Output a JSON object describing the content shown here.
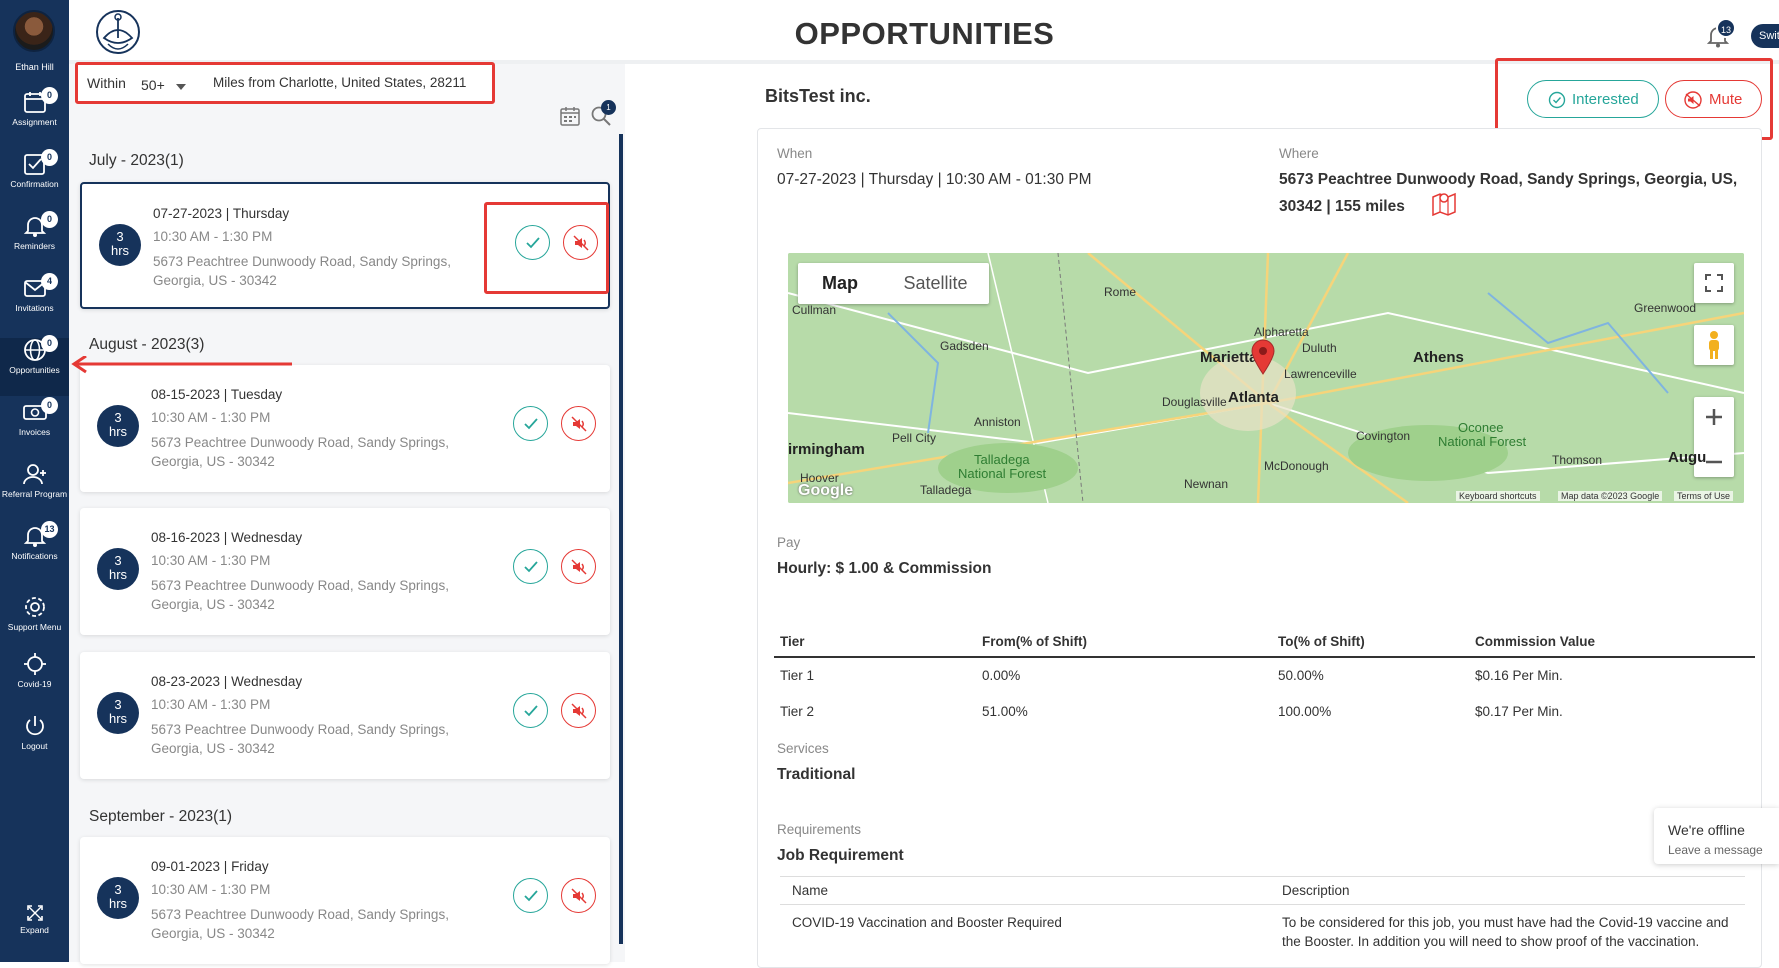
{
  "user": {
    "name": "Ethan Hill"
  },
  "sidebar": {
    "items": [
      {
        "label": "Assignment",
        "badge": "0",
        "icon": "calendar-icon"
      },
      {
        "label": "Confirmation",
        "badge": "0",
        "icon": "check-square-icon"
      },
      {
        "label": "Reminders",
        "badge": "0",
        "icon": "bell-icon"
      },
      {
        "label": "Invitations",
        "badge": "4",
        "icon": "mail-icon"
      },
      {
        "label": "Opportunities",
        "badge": "0",
        "icon": "globe-icon"
      },
      {
        "label": "Invoices",
        "badge": "0",
        "icon": "dollar-icon"
      },
      {
        "label": "Referral Program",
        "badge": "",
        "icon": "add-user-icon"
      },
      {
        "label": "Notifications",
        "badge": "13",
        "icon": "bell-icon"
      },
      {
        "label": "Support Menu",
        "badge": "",
        "icon": "gear-icon"
      },
      {
        "label": "Covid-19",
        "badge": "",
        "icon": "virus-icon"
      },
      {
        "label": "Logout",
        "badge": "",
        "icon": "power-icon"
      }
    ],
    "expand_label": "Expand"
  },
  "header": {
    "title": "OPPORTUNITIES",
    "notif_count": "13",
    "switch_label": "Swit"
  },
  "filter": {
    "within_label": "Within",
    "miles_value": "50+",
    "miles_from": "Miles from Charlotte, United States, 28211",
    "search_badge": "1"
  },
  "months": [
    {
      "title": "July - 2023(1)"
    },
    {
      "title": "August - 2023(3)"
    },
    {
      "title": "September - 2023(1)"
    }
  ],
  "cards": [
    {
      "hours": "3",
      "unit": "hrs",
      "date": "07-27-2023 | Thursday",
      "time": "10:30 AM - 1:30 PM",
      "address": "5673 Peachtree Dunwoody Road, Sandy Springs, Georgia, US - 30342"
    },
    {
      "hours": "3",
      "unit": "hrs",
      "date": "08-15-2023 | Tuesday",
      "time": "10:30 AM - 1:30 PM",
      "address": "5673 Peachtree Dunwoody Road, Sandy Springs, Georgia, US - 30342"
    },
    {
      "hours": "3",
      "unit": "hrs",
      "date": "08-16-2023 | Wednesday",
      "time": "10:30 AM - 1:30 PM",
      "address": "5673 Peachtree Dunwoody Road, Sandy Springs, Georgia, US - 30342"
    },
    {
      "hours": "3",
      "unit": "hrs",
      "date": "08-23-2023 | Wednesday",
      "time": "10:30 AM - 1:30 PM",
      "address": "5673 Peachtree Dunwoody Road, Sandy Springs, Georgia, US - 30342"
    },
    {
      "hours": "3",
      "unit": "hrs",
      "date": "09-01-2023 | Friday",
      "time": "10:30 AM - 1:30 PM",
      "address": "5673 Peachtree Dunwoody Road, Sandy Springs, Georgia, US - 30342"
    }
  ],
  "detail": {
    "company": "BitsTest inc.",
    "interested_label": "Interested",
    "mute_label": "Mute",
    "when_label": "When",
    "when_value": "07-27-2023 | Thursday | 10:30 AM - 01:30 PM",
    "where_label": "Where",
    "where_line1": "5673 Peachtree Dunwoody Road, Sandy Springs, Georgia, US,",
    "where_line2": "30342 | 155 miles",
    "pay_label": "Pay",
    "pay_value": "Hourly: $ 1.00 & Commission",
    "tier_headers": [
      "Tier",
      "From(% of Shift)",
      "To(% of Shift)",
      "Commission Value"
    ],
    "tiers": [
      [
        "Tier 1",
        "0.00%",
        "50.00%",
        "$0.16 Per Min."
      ],
      [
        "Tier 2",
        "51.00%",
        "100.00%",
        "$0.17 Per Min."
      ]
    ],
    "services_label": "Services",
    "services_value": "Traditional",
    "requirements_label": "Requirements",
    "job_requirement_title": "Job Requirement",
    "req_headers": [
      "Name",
      "Description"
    ],
    "req_rows": [
      [
        "COVID-19 Vaccination and Booster Required",
        "To be considered for this job, you must have had the Covid-19 vaccine and the Booster. In addition you will need to show proof of the vaccination."
      ]
    ]
  },
  "map": {
    "map_tab": "Map",
    "satellite_tab": "Satellite",
    "labels": {
      "cullman": "Cullman",
      "rome": "Rome",
      "gadsden": "Gadsden",
      "alpharetta": "Alpharetta",
      "duluth": "Duluth",
      "marietta": "Marietta",
      "athens": "Athens",
      "lawrenceville": "Lawrenceville",
      "douglasville": "Douglasville",
      "atlanta": "Atlanta",
      "greenwood": "Greenwood",
      "anniston": "Anniston",
      "pell_city": "Pell City",
      "birmingham": "irmingham",
      "covington": "Covington",
      "oconee": "Oconee",
      "oconee2": "National Forest",
      "talladega": "Talladega",
      "talladega2": "National Forest",
      "talladega_town": "Talladega",
      "mcdonough": "McDonough",
      "thomson": "Thomson",
      "augusta": "Augu",
      "hoover": "Hoover",
      "newnan": "Newnan"
    },
    "footer": [
      "Keyboard shortcuts",
      "Map data ©2023 Google",
      "Terms of Use"
    ],
    "google": "Google"
  },
  "chat": {
    "status": "We're offline",
    "prompt": "Leave a message"
  }
}
